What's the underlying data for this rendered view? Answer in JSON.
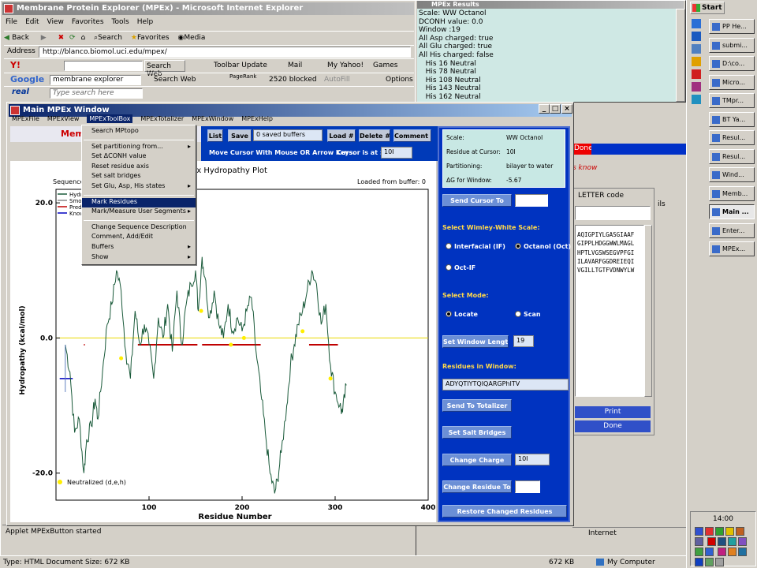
{
  "ie": {
    "title": "Membrane Protein Explorer (MPEx) - Microsoft Internet Explorer",
    "menu": [
      "File",
      "Edit",
      "View",
      "Favorites",
      "Tools",
      "Help"
    ],
    "toolbar": {
      "back": "Back",
      "search": "Search",
      "favorites": "Favorites",
      "media": "Media"
    },
    "address_label": "Address",
    "address_url": "http://blanco.biomol.uci.edu/mpex/",
    "yahoo": {
      "search_btn": "Search Web",
      "toolbar_update": "Toolbar Update",
      "mail": "Mail",
      "my_yahoo": "My Yahoo!",
      "games": "Games"
    },
    "google": {
      "query": "membrane explorer",
      "search_btn": "Search Web",
      "pagerank": "PageRank",
      "blocked": "2520 blocked",
      "autofill": "AutoFill",
      "options": "Options"
    },
    "real": {
      "placeholder": "Type search here"
    },
    "status": {
      "text": "Applet MPExButton started",
      "zone": "Internet"
    }
  },
  "results": {
    "title": "MPEx Results",
    "lines": [
      "Scale: WW Octanol",
      "DCONH value: 0.0",
      "Window :19",
      "All Asp charged: true",
      "All Glu charged: true",
      "All His charged: false",
      "   His 16 Neutral",
      "   His 78 Neutral",
      "   His 108 Neutral",
      "   His 143 Neutral",
      "   His 162 Neutral"
    ]
  },
  "main": {
    "title": "Main MPEx Window",
    "menu": [
      "MPExFile",
      "MPExView",
      "MPExToolBox",
      "MPExTotalizer",
      "MPExWindow",
      "MPExHelp"
    ],
    "banner": "Mem",
    "list_btn": "List",
    "save_btn": "Save",
    "buffers": "0 saved buffers",
    "load_btn": "Load #",
    "delete_btn": "Delete #",
    "comment_btn": "Comment #",
    "hint": "Move Cursor With Mouse OR Arrow Keys.",
    "cursor_label": "Cursor is at :",
    "cursor_value": "10I",
    "plot_title": "Ex Hydropathy Plot",
    "seq_label": "Sequence",
    "loaded": "Loaded from buffer:  0",
    "legend": [
      "Hydro",
      "Smoo",
      "Predi",
      "Know"
    ],
    "neutralized": "Neutralized (d,e,h)",
    "info": {
      "scale_l": "Scale:",
      "scale_v": "WW Octanol",
      "res_l": "Residue at Cursor:",
      "res_v": "10I",
      "part_l": "Partitioning:",
      "part_v": "bilayer to water",
      "dg_l": "ΔG for Window:",
      "dg_v": "-5.67"
    },
    "send_cursor": "Send Cursor To",
    "scale_hdr": "Select Wimley-White Scale:",
    "scale_opts": [
      "Interfacial (IF)",
      "Octanol (Oct)",
      "Oct-IF"
    ],
    "mode_hdr": "Select Mode:",
    "mode_opts": [
      "Locate",
      "Scan"
    ],
    "set_window": "Set Window Length",
    "window_value": "19",
    "residues_hdr": "Residues in Window:",
    "residues_value": "ADYQTIYTQIQARGPhITV",
    "send_totalizer": "Send To Totalizer",
    "salt_bridges": "Set Salt Bridges",
    "change_charge": "Change Charge",
    "charge_value": "10I",
    "change_residue": "Change Residue To",
    "restore": "Restore Changed Residues"
  },
  "toolbox_menu": {
    "items": [
      "Search MPtopo",
      "-",
      "Set partitioning from...",
      "Set  ΔCONH value",
      "Reset residue axis",
      "Set salt bridges",
      "Set Glu, Asp, His states",
      "-",
      "Mark Residues",
      "Mark/Measure User Segments",
      "-",
      "Change Sequence Description",
      "Comment, Add/Edit",
      "Buffers",
      "Show"
    ],
    "submenu": [
      "Set partitioning from...",
      "Set Glu, Asp, His states",
      "Mark/Measure User Segments",
      "Buffers",
      "Show"
    ],
    "highlight": "Mark Residues"
  },
  "behind": {
    "done": "Done",
    "know": "s know",
    "letter": "LETTER code",
    "ils": "ils",
    "sequence": [
      "AQIGPIYLGASGIAAF",
      "GIPPLHDGGWWLMAGL",
      "HPTLVGSWSEGVPFGI",
      "ILAVARFGGDREIEQI",
      "VGILLTGTFVDNWYLW"
    ],
    "print": "Print",
    "done2": "Done"
  },
  "taskbar": {
    "start": "Start",
    "items": [
      "PP He...",
      "submi...",
      "D:\\co...",
      "Micro...",
      "TMpr...",
      "BT Ya...",
      "Resul...",
      "Resul...",
      "Wind...",
      "Memb...",
      "Main ...",
      "Enter...",
      "MPEx..."
    ],
    "active": "Main ...",
    "clock": "14:00"
  },
  "statusbar": {
    "type": "Type: HTML Document Size: 672 KB",
    "size": "672 KB",
    "computer": "My Computer"
  },
  "chart_data": {
    "type": "line",
    "title": "Ex Hydropathy Plot",
    "xlabel": "Residue Number",
    "ylabel": "Hydropathy (kcal/mol)",
    "xlim": [
      0,
      400
    ],
    "ylim": [
      -24,
      22
    ],
    "xticks": [
      100,
      200,
      300,
      400
    ],
    "yticks": [
      20.0,
      0.0,
      -20.0
    ],
    "series": [
      {
        "values": [
          [
            10,
            -1
          ],
          [
            15,
            -5
          ],
          [
            20,
            -14
          ],
          [
            25,
            -12
          ],
          [
            30,
            -20
          ],
          [
            33,
            -15
          ],
          [
            38,
            -13
          ],
          [
            42,
            -9
          ],
          [
            45,
            -12
          ],
          [
            50,
            -5
          ],
          [
            55,
            2
          ],
          [
            60,
            5
          ],
          [
            65,
            10
          ],
          [
            70,
            7
          ],
          [
            75,
            -2
          ],
          [
            80,
            -6
          ],
          [
            85,
            4
          ],
          [
            90,
            -1
          ],
          [
            95,
            2
          ],
          [
            100,
            -1
          ],
          [
            105,
            -6
          ],
          [
            110,
            3
          ],
          [
            115,
            0
          ],
          [
            120,
            5
          ],
          [
            125,
            -2
          ],
          [
            130,
            7
          ],
          [
            135,
            -1
          ],
          [
            140,
            5
          ],
          [
            145,
            8
          ],
          [
            150,
            10
          ],
          [
            153,
            4
          ],
          [
            157,
            12
          ],
          [
            160,
            9
          ],
          [
            165,
            3
          ],
          [
            170,
            7
          ],
          [
            175,
            2
          ],
          [
            180,
            0
          ],
          [
            185,
            5
          ],
          [
            190,
            1
          ],
          [
            195,
            3
          ],
          [
            200,
            1
          ],
          [
            205,
            4
          ],
          [
            210,
            6
          ],
          [
            215,
            -2
          ],
          [
            220,
            -8
          ],
          [
            225,
            -14
          ],
          [
            230,
            -20
          ],
          [
            235,
            -23
          ],
          [
            238,
            -21
          ],
          [
            242,
            -17
          ],
          [
            248,
            -10
          ],
          [
            252,
            -4
          ],
          [
            256,
            -1
          ],
          [
            260,
            2
          ],
          [
            265,
            4
          ],
          [
            270,
            7
          ],
          [
            275,
            10
          ],
          [
            280,
            8
          ],
          [
            285,
            2
          ],
          [
            290,
            5
          ],
          [
            295,
            -4
          ],
          [
            300,
            -8
          ],
          [
            305,
            -10
          ],
          [
            308,
            -11
          ],
          [
            312,
            -7
          ]
        ]
      }
    ],
    "predicted_segments": [
      [
        30,
        31
      ],
      [
        88,
        152
      ],
      [
        157,
        220
      ],
      [
        272,
        303
      ]
    ],
    "predicted_level": -1,
    "neutral_points": [
      [
        70,
        -3
      ],
      [
        156,
        4
      ],
      [
        188,
        -1
      ],
      [
        202,
        0
      ],
      [
        265,
        1
      ],
      [
        295,
        -6
      ]
    ],
    "colors": {
      "line": "#1a5a3a",
      "predicted": "#c00000",
      "neutral": "#ffee00",
      "zero": "#e8d800",
      "known": "#0000c0"
    }
  }
}
